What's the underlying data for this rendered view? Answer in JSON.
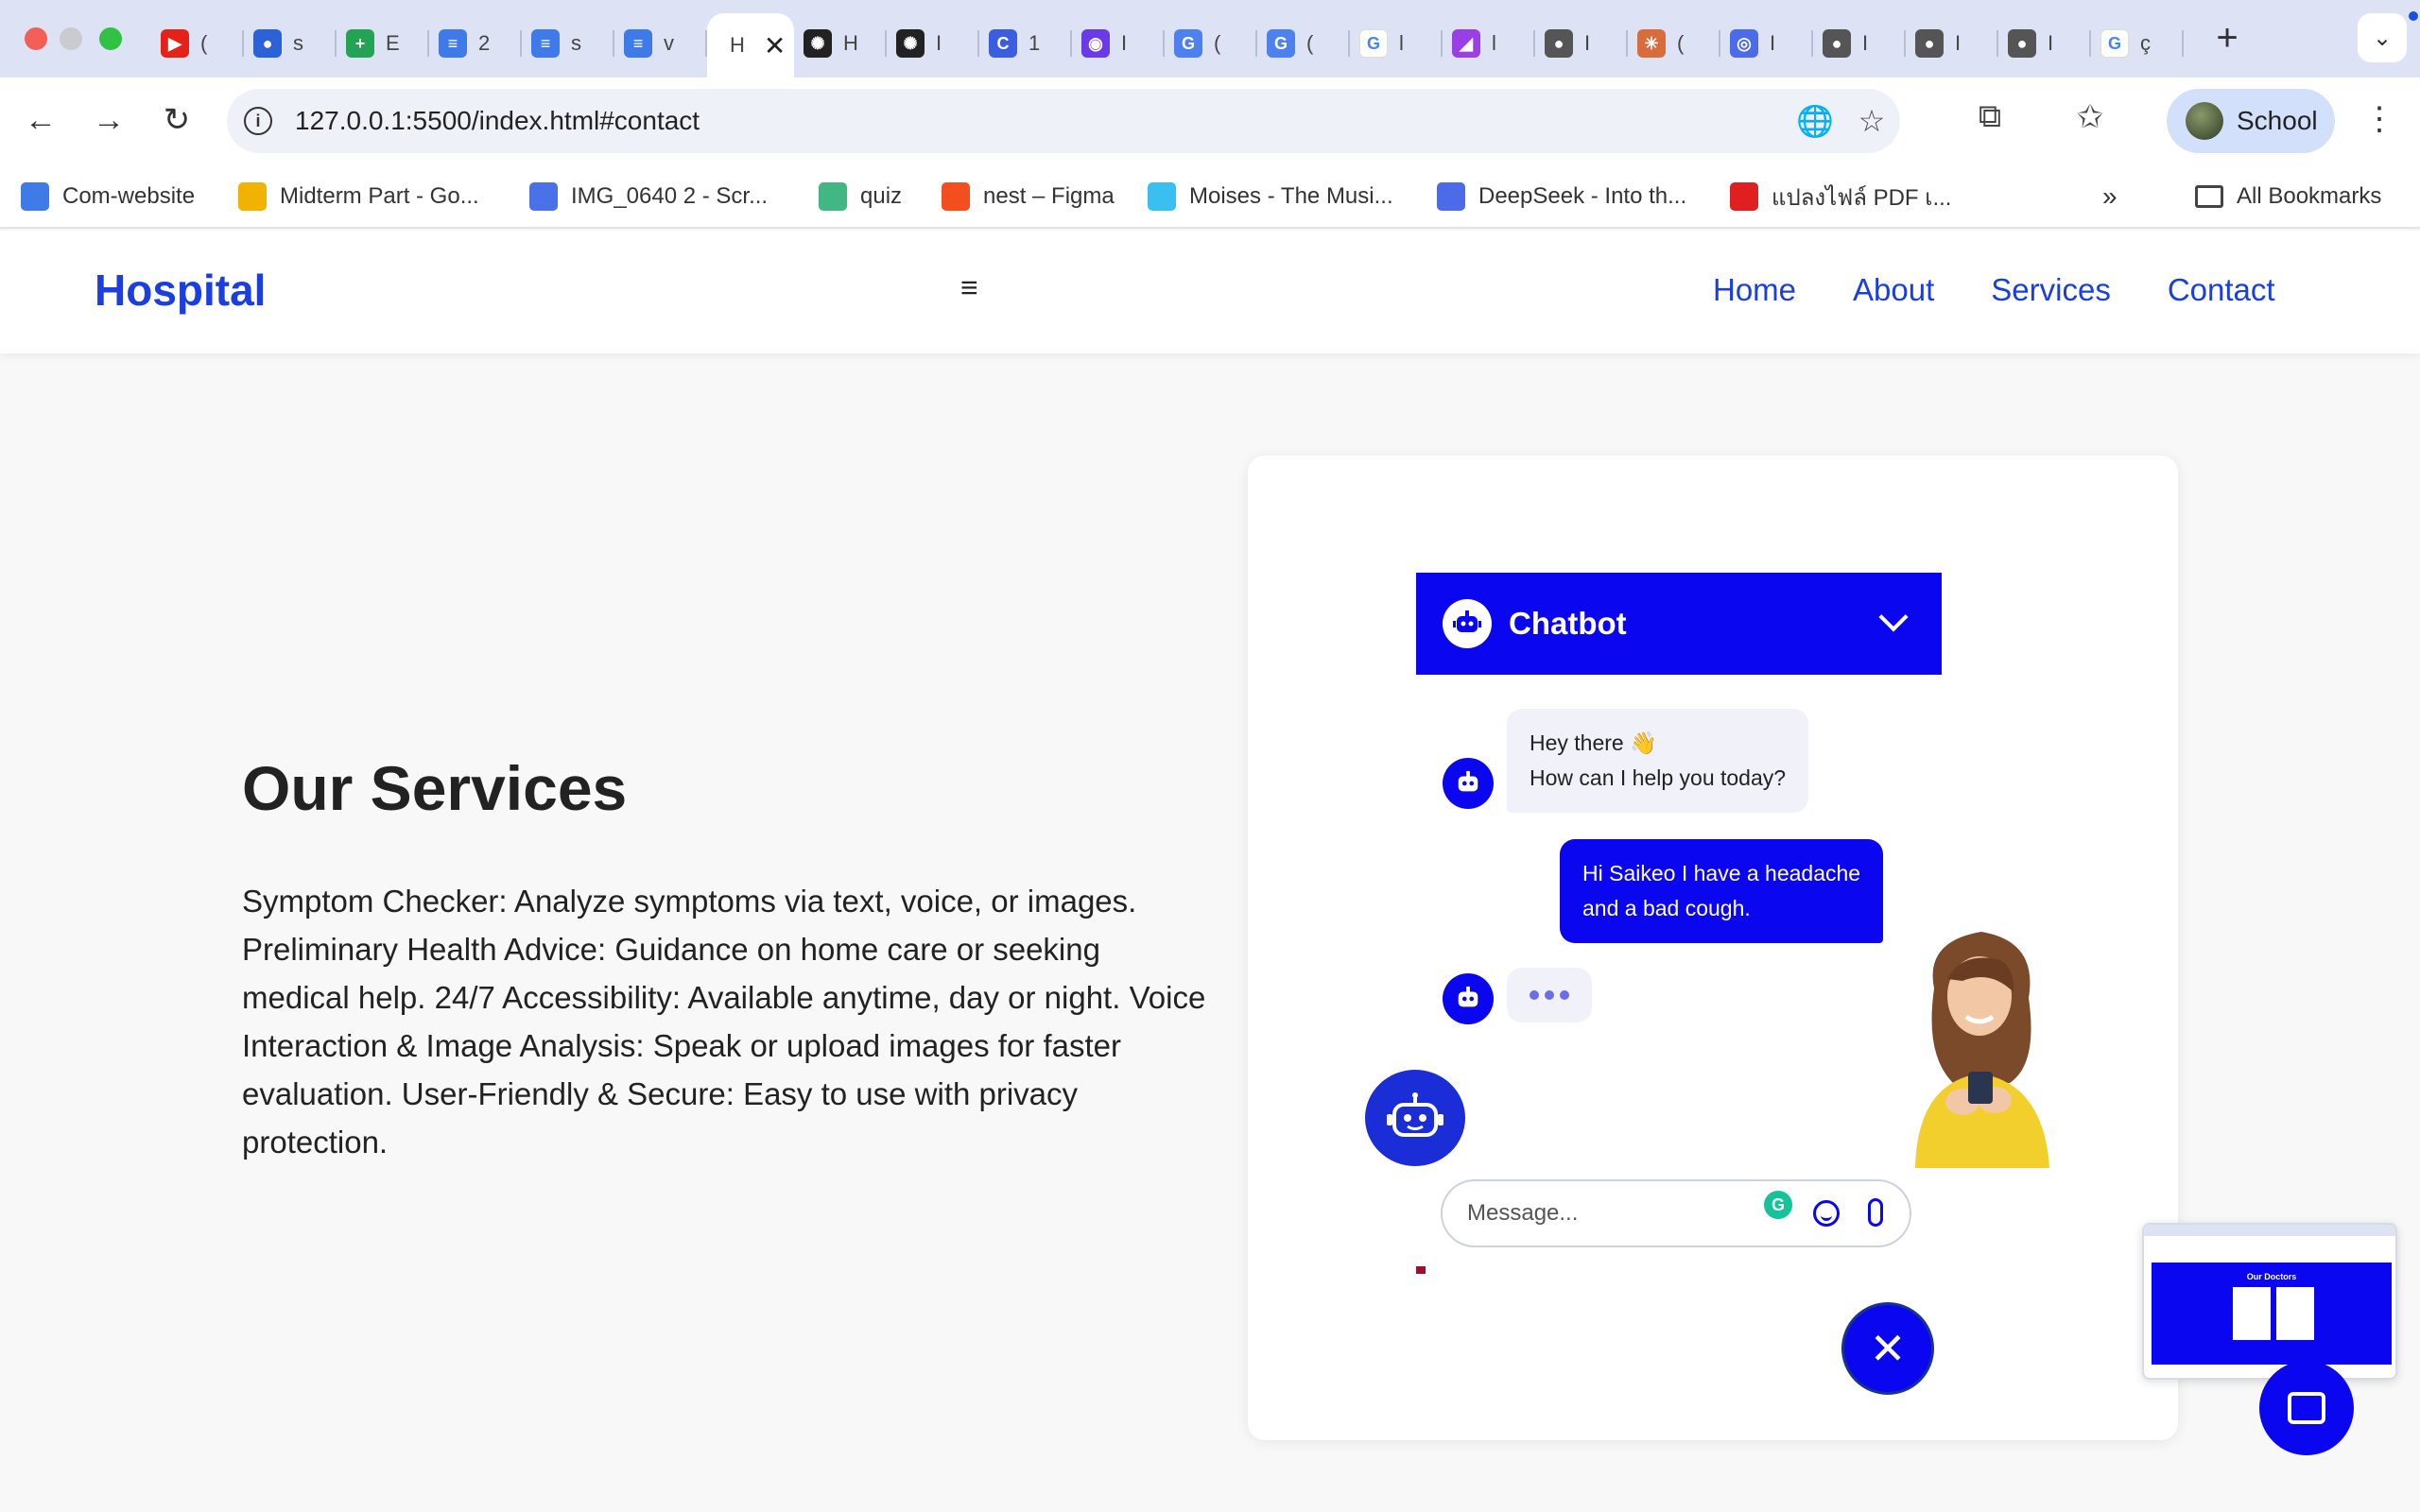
{
  "browser": {
    "tabs": [
      {
        "char": "(",
        "color": "#e62117",
        "glyph": "▶"
      },
      {
        "char": "s",
        "color": "#2c62d8",
        "glyph": "●"
      },
      {
        "char": "E",
        "color": "#23a455",
        "glyph": "+"
      },
      {
        "char": "2",
        "color": "#3f7be8",
        "glyph": "≡"
      },
      {
        "char": "s",
        "color": "#3f7be8",
        "glyph": "≡"
      },
      {
        "char": "v",
        "color": "#3f7be8",
        "glyph": "≡"
      },
      {
        "char": "H",
        "color": "#ffffff",
        "glyph": "",
        "active": true
      },
      {
        "char": "H",
        "color": "#222222",
        "glyph": "✺"
      },
      {
        "char": "I",
        "color": "#222222",
        "glyph": "✺"
      },
      {
        "char": "1",
        "color": "#3b5de0",
        "glyph": "C"
      },
      {
        "char": "I",
        "color": "#6a3ae6",
        "glyph": "◉"
      },
      {
        "char": "(",
        "color": "#4d82ee",
        "glyph": "G"
      },
      {
        "char": "(",
        "color": "#4d82ee",
        "glyph": "G"
      },
      {
        "char": "l",
        "color": "#ffffff",
        "glyph": "G"
      },
      {
        "char": "l",
        "color": "#9a3ee6",
        "glyph": "◢"
      },
      {
        "char": "I",
        "color": "#555555",
        "glyph": "●"
      },
      {
        "char": "(",
        "color": "#d96c3c",
        "glyph": "✳"
      },
      {
        "char": "I",
        "color": "#4b6be8",
        "glyph": "◎"
      },
      {
        "char": "I",
        "color": "#555555",
        "glyph": "●"
      },
      {
        "char": "I",
        "color": "#555555",
        "glyph": "●"
      },
      {
        "char": "I",
        "color": "#555555",
        "glyph": "●"
      },
      {
        "char": "ç",
        "color": "#ffffff",
        "glyph": "G"
      }
    ],
    "url": "127.0.0.1:5500/index.html#contact",
    "profile_name": "School",
    "bookmarks": [
      {
        "label": "Com-website",
        "icon": "docs-icon",
        "color": "#3f7be8"
      },
      {
        "label": "Midterm Part - Go...",
        "icon": "drive-icon",
        "color": "#f2b300"
      },
      {
        "label": "IMG_0640 2 - Scr...",
        "icon": "audio-icon",
        "color": "#4a72e8"
      },
      {
        "label": "quiz",
        "icon": "vue-icon",
        "color": "#41b883"
      },
      {
        "label": "nest – Figma",
        "icon": "figma-icon",
        "color": "#f24e1e"
      },
      {
        "label": "Moises - The Musi...",
        "icon": "wave-icon",
        "color": "#39c0f0"
      },
      {
        "label": "DeepSeek - Into th...",
        "icon": "whale-icon",
        "color": "#4b6be8"
      },
      {
        "label": "แปลงไฟล์ PDF เ...",
        "icon": "pdf-icon",
        "color": "#e02020"
      }
    ],
    "all_bookmarks": "All Bookmarks",
    "bookmarks_overflow": "»",
    "active_tab_char": "H"
  },
  "site": {
    "logo": "Hospital",
    "hamburger": "≡",
    "nav": [
      "Home",
      "About",
      "Services",
      "Contact"
    ]
  },
  "services": {
    "title": "Our Services",
    "text": "Symptom Checker: Analyze symptoms via text, voice, or images. Preliminary Health Advice: Guidance on home care or seeking medical help. 24/7 Accessibility: Available anytime, day or night. Voice Interaction & Image Analysis: Speak or upload images for faster evaluation. User-Friendly & Secure: Easy to use with privacy protection."
  },
  "chatbot": {
    "title": "Chatbot",
    "bot_greeting_line1": "Hey there 👋",
    "bot_greeting_line2": "How can I help you today?",
    "user_message_line1": "Hi Saikeo I have a headache",
    "user_message_line2": "and a bad cough.",
    "input_placeholder": "Message...",
    "accent_color": "#0a06f0"
  },
  "thumbnail": {
    "title": "Our Doctors"
  }
}
